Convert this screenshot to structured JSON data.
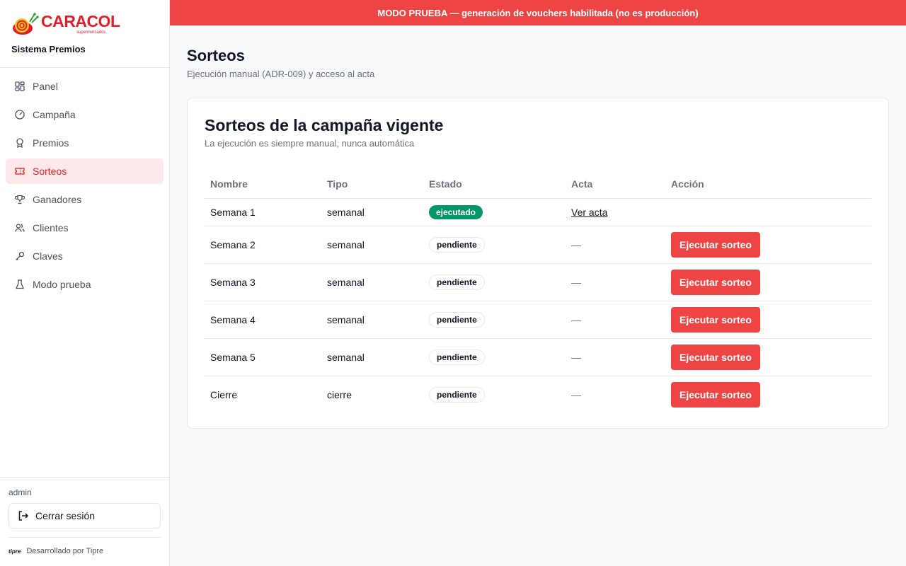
{
  "brand": {
    "logo_word": "CARACOL",
    "logo_sub": "supermercados",
    "app_name": "Sistema Premios"
  },
  "sidebar": {
    "items": [
      {
        "label": "Panel",
        "icon": "grid-icon"
      },
      {
        "label": "Campaña",
        "icon": "gauge-icon"
      },
      {
        "label": "Premios",
        "icon": "award-icon"
      },
      {
        "label": "Sorteos",
        "icon": "ticket-icon",
        "active": true
      },
      {
        "label": "Ganadores",
        "icon": "trophy-icon"
      },
      {
        "label": "Clientes",
        "icon": "users-icon"
      },
      {
        "label": "Claves",
        "icon": "key-icon"
      },
      {
        "label": "Modo prueba",
        "icon": "flask-icon"
      }
    ],
    "user": "admin",
    "logout_label": "Cerrar sesión",
    "credit_logo": "tipre",
    "credit_text": "Desarrollado por Tipre"
  },
  "banner": {
    "text": "MODO PRUEBA — generación de vouchers habilitada (no es producción)",
    "color": "#ef4444"
  },
  "page": {
    "title": "Sorteos",
    "subtitle": "Ejecución manual (ADR-009) y acceso al acta"
  },
  "card": {
    "title": "Sorteos de la campaña vigente",
    "subtitle": "La ejecución es siempre manual, nunca automática"
  },
  "table": {
    "headers": [
      "Nombre",
      "Tipo",
      "Estado",
      "Acta",
      "Acción"
    ],
    "rows": [
      {
        "nombre": "Semana 1",
        "tipo": "semanal",
        "estado": "ejecutado",
        "acta": "Ver acta",
        "accion": ""
      },
      {
        "nombre": "Semana 2",
        "tipo": "semanal",
        "estado": "pendiente",
        "acta": "—",
        "accion": "Ejecutar sorteo"
      },
      {
        "nombre": "Semana 3",
        "tipo": "semanal",
        "estado": "pendiente",
        "acta": "—",
        "accion": "Ejecutar sorteo"
      },
      {
        "nombre": "Semana 4",
        "tipo": "semanal",
        "estado": "pendiente",
        "acta": "—",
        "accion": "Ejecutar sorteo"
      },
      {
        "nombre": "Semana 5",
        "tipo": "semanal",
        "estado": "pendiente",
        "acta": "—",
        "accion": "Ejecutar sorteo"
      },
      {
        "nombre": "Cierre",
        "tipo": "cierre",
        "estado": "pendiente",
        "acta": "—",
        "accion": "Ejecutar sorteo"
      }
    ]
  },
  "colors": {
    "accent": "#ef4444",
    "active_bg": "#fde8ea",
    "success": "#059669"
  }
}
